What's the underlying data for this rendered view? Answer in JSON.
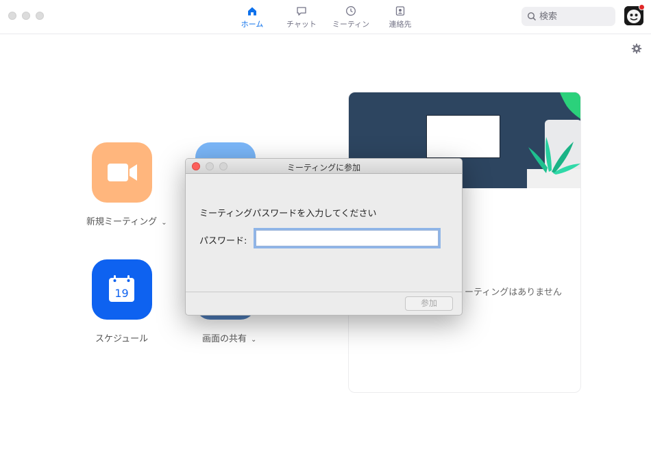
{
  "nav": {
    "tabs": [
      {
        "label": "ホーム",
        "icon": "home-icon",
        "active": true
      },
      {
        "label": "チャット",
        "icon": "chat-icon",
        "active": false
      },
      {
        "label": "ミーティン",
        "icon": "clock-icon",
        "active": false
      },
      {
        "label": "連絡先",
        "icon": "contacts-icon",
        "active": false
      }
    ]
  },
  "search": {
    "placeholder": "検索"
  },
  "home": {
    "new_meeting_label": "新規ミーティング",
    "schedule_label": "スケジュール",
    "share_screen_label": "画面の共有",
    "calendar_day": "19"
  },
  "card": {
    "no_meetings_text": "ーティングはありません"
  },
  "dialog": {
    "title": "ミーティングに参加",
    "message": "ミーティングパスワードを入力してください",
    "password_label": "パスワード:",
    "password_value": "",
    "join_button": "参加"
  },
  "colors": {
    "accent": "#0e71eb",
    "new_meeting": "#ffb67d",
    "schedule": "#0e62f0",
    "share": "#7ab6f8",
    "banner": "#2d4560"
  }
}
